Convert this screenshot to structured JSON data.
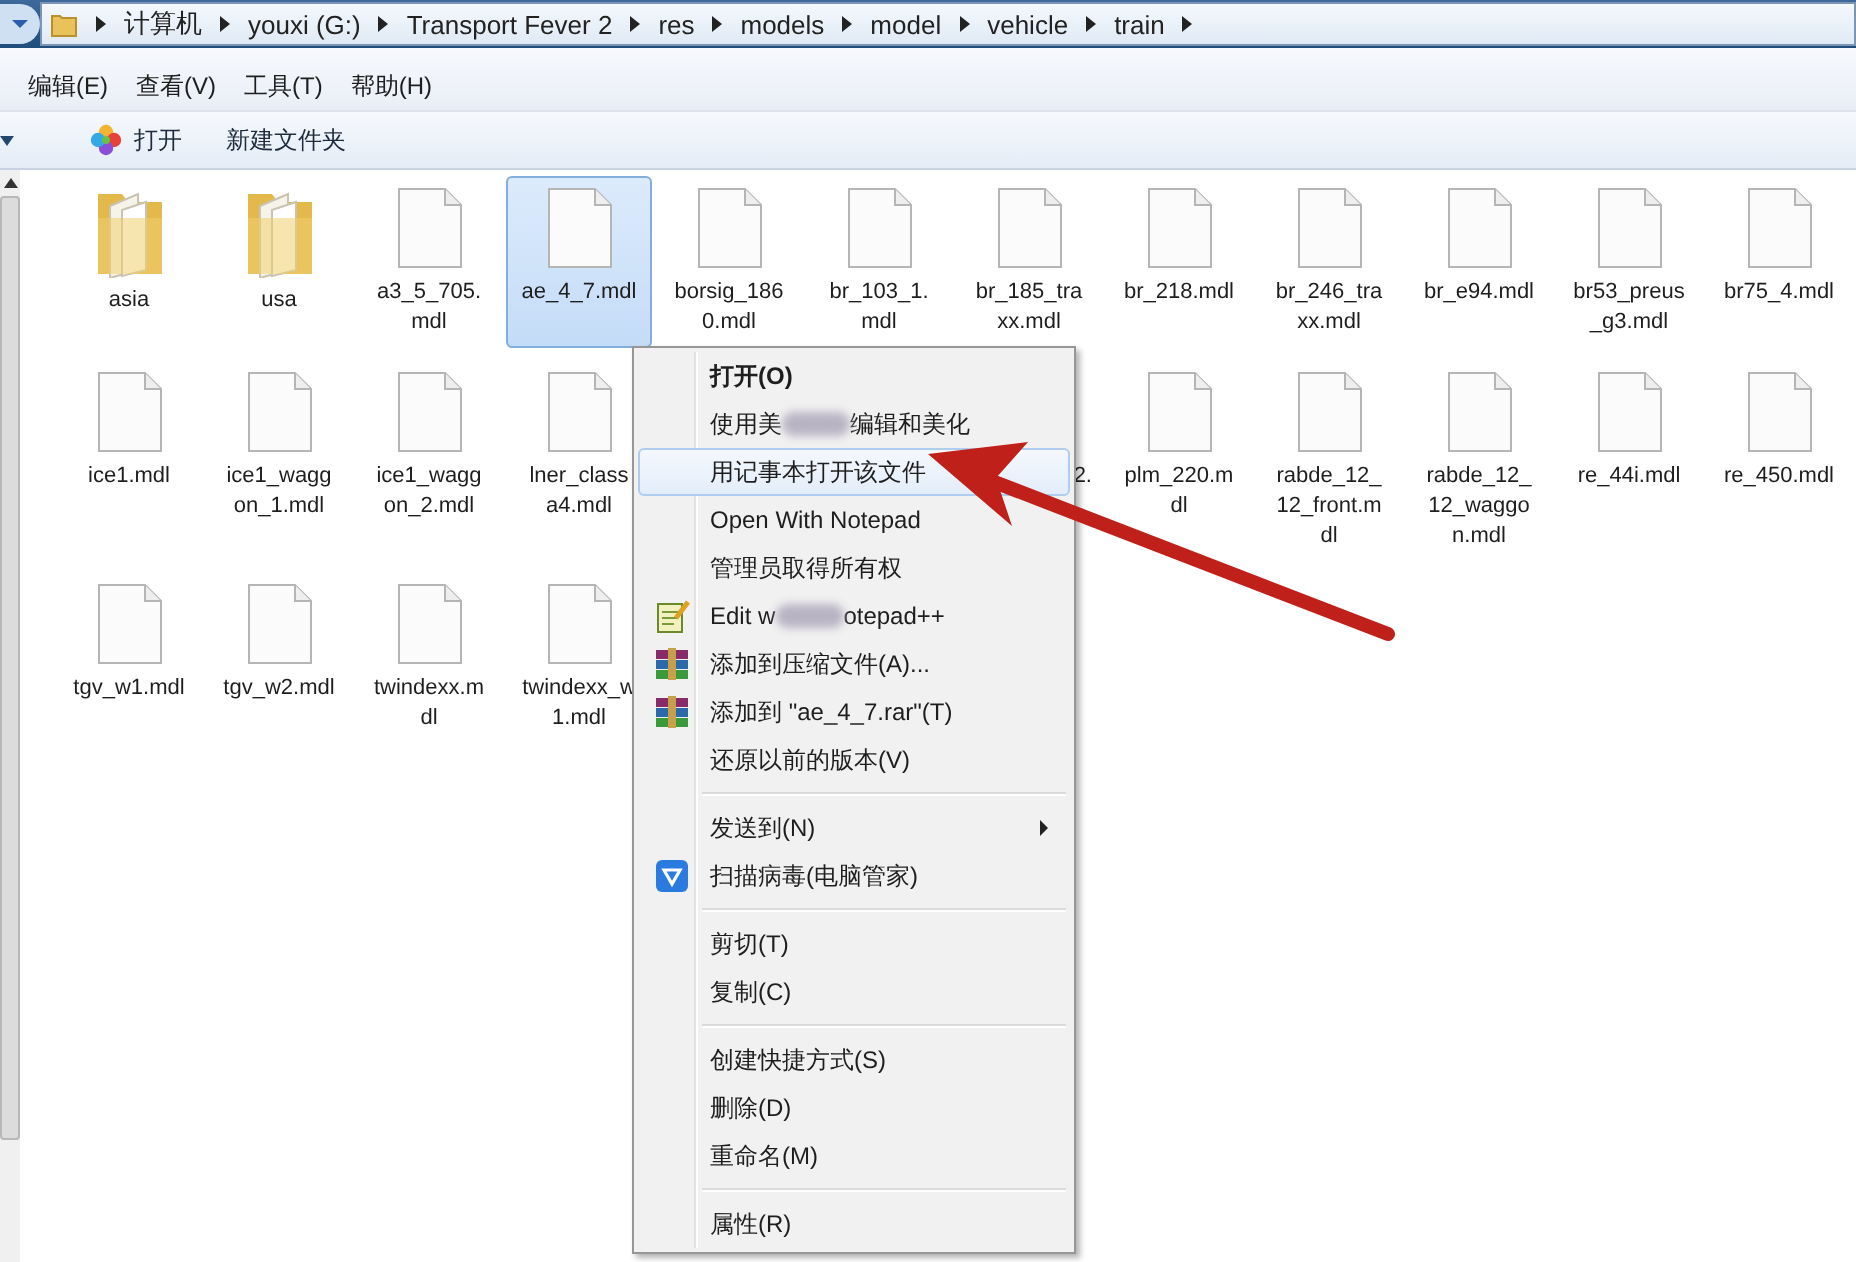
{
  "address_bar": {
    "segments": [
      "计算机",
      "youxi (G:)",
      "Transport Fever 2",
      "res",
      "models",
      "model",
      "vehicle",
      "train"
    ]
  },
  "menu_bar": [
    "编辑(E)",
    "查看(V)",
    "工具(T)",
    "帮助(H)"
  ],
  "toolbar": [
    {
      "label": "打开"
    },
    {
      "label": "新建文件夹"
    }
  ],
  "files": [
    {
      "kind": "folder",
      "name": "asia",
      "selected": false
    },
    {
      "kind": "folder",
      "name": "usa",
      "selected": false
    },
    {
      "kind": "file",
      "name": "a3_5_705.mdl",
      "selected": false
    },
    {
      "kind": "file",
      "name": "ae_4_7.mdl",
      "selected": true
    },
    {
      "kind": "file",
      "name": "borsig_1860.mdl",
      "selected": false
    },
    {
      "kind": "file",
      "name": "br_103_1.mdl",
      "selected": false
    },
    {
      "kind": "file",
      "name": "br_185_traxx.mdl",
      "selected": false
    },
    {
      "kind": "file",
      "name": "br_218.mdl",
      "selected": false
    },
    {
      "kind": "file",
      "name": "br_246_traxx.mdl",
      "selected": false
    },
    {
      "kind": "file",
      "name": "br_e94.mdl",
      "selected": false
    },
    {
      "kind": "file",
      "name": "br53_preus_g3.mdl",
      "selected": false
    },
    {
      "kind": "file",
      "name": "br75_4.mdl",
      "selected": false
    },
    {
      "kind": "file",
      "name": "ice1.mdl",
      "selected": false
    },
    {
      "kind": "file",
      "name": "ice1_waggon_1.mdl",
      "selected": false
    },
    {
      "kind": "file",
      "name": "ice1_waggon_2.mdl",
      "selected": false
    },
    {
      "kind": "file",
      "name": "lner_class a4.mdl",
      "selected": false
    },
    {
      "kind": "covered"
    },
    {
      "kind": "covered"
    },
    {
      "kind": "partly_covered",
      "name": "2."
    },
    {
      "kind": "file",
      "name": "plm_220.mdl",
      "selected": false
    },
    {
      "kind": "file",
      "name": "rabde_12_12_front.mdl",
      "selected": false
    },
    {
      "kind": "file",
      "name": "rabde_12_12_waggon.mdl",
      "selected": false
    },
    {
      "kind": "file",
      "name": "re_44i.mdl",
      "selected": false
    },
    {
      "kind": "file",
      "name": "re_450.mdl",
      "selected": false
    },
    {
      "kind": "file",
      "name": "tgv_w1.mdl",
      "selected": false
    },
    {
      "kind": "file",
      "name": "tgv_w2.mdl",
      "selected": false
    },
    {
      "kind": "file",
      "name": "twindexx.mdl",
      "selected": false
    },
    {
      "kind": "file",
      "name": "twindexx_w1.mdl",
      "selected": false
    }
  ],
  "context_menu": [
    [
      {
        "kind": "text",
        "label": "打开(O)",
        "default": true,
        "selected": false,
        "submenu": false
      },
      {
        "kind": "blurred",
        "parts": [
          "使用美",
          "编辑和美化"
        ],
        "default": false,
        "selected": false,
        "submenu": false
      },
      {
        "kind": "text",
        "label": "用记事本打开该文件",
        "default": false,
        "selected": true,
        "submenu": false
      },
      {
        "kind": "text",
        "label": "Open With Notepad",
        "default": false,
        "selected": false,
        "submenu": false
      },
      {
        "kind": "text",
        "label": "管理员取得所有权",
        "default": false,
        "selected": false,
        "submenu": false
      },
      {
        "kind": "blurred",
        "parts": [
          "Edit w",
          "otepad++"
        ],
        "default": false,
        "selected": false,
        "submenu": false
      },
      {
        "kind": "text",
        "label": "添加到压缩文件(A)...",
        "default": false,
        "selected": false,
        "submenu": false
      },
      {
        "kind": "text",
        "label": "添加到 \"ae_4_7.rar\"(T)",
        "default": false,
        "selected": false,
        "submenu": false
      },
      {
        "kind": "text",
        "label": "还原以前的版本(V)",
        "default": false,
        "selected": false,
        "submenu": false
      }
    ],
    [
      {
        "kind": "text",
        "label": "发送到(N)",
        "default": false,
        "selected": false,
        "submenu": true
      },
      {
        "kind": "text",
        "label": "扫描病毒(电脑管家)",
        "default": false,
        "selected": false,
        "submenu": false
      }
    ],
    [
      {
        "kind": "text",
        "label": "剪切(T)",
        "default": false,
        "selected": false,
        "submenu": false
      },
      {
        "kind": "text",
        "label": "复制(C)",
        "default": false,
        "selected": false,
        "submenu": false
      }
    ],
    [
      {
        "kind": "text",
        "label": "创建快捷方式(S)",
        "default": false,
        "selected": false,
        "submenu": false
      },
      {
        "kind": "text",
        "label": "删除(D)",
        "default": false,
        "selected": false,
        "submenu": false
      },
      {
        "kind": "text",
        "label": "重命名(M)",
        "default": false,
        "selected": false,
        "submenu": false
      }
    ],
    [
      {
        "kind": "text",
        "label": "属性(R)",
        "default": false,
        "selected": false,
        "submenu": false
      }
    ]
  ]
}
